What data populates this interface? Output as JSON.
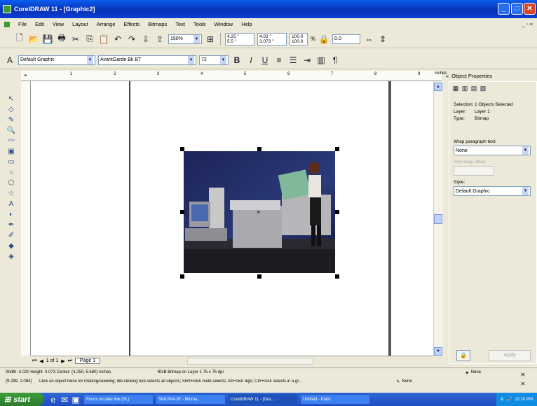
{
  "window": {
    "title": "CorelDRAW 11 - [Graphic2]",
    "buttons": {
      "minimize": "_",
      "maximize": "□",
      "close": "✕"
    }
  },
  "menubar": {
    "items": [
      "File",
      "Edit",
      "View",
      "Layout",
      "Arrange",
      "Effects",
      "Bitmaps",
      "Text",
      "Tools",
      "Window",
      "Help"
    ],
    "doc_controls": "_ ▫ ×"
  },
  "toolbar_standard": {
    "zoom_value": "150%",
    "snap_value": "",
    "x_value": "4.25 \"",
    "y_value": "5.5 \"",
    "w_value": "4.02 \"",
    "h_value": "3.073 \"",
    "scale_x": "100.0",
    "scale_y": "100.0",
    "pct": "%",
    "rotation_value": "0.0"
  },
  "toolbar_text": {
    "style_select": "Default Graphic",
    "font_select": "AvantGarde Bk BT",
    "size_select": "72",
    "bold": "B",
    "italic": "I",
    "underline": "U"
  },
  "ruler": {
    "top_label": "inches",
    "ticks": [
      "1",
      "2",
      "3",
      "4",
      "5",
      "6",
      "7",
      "8",
      "9"
    ]
  },
  "docker": {
    "title": "Object Properties",
    "selection_label": "Selection:",
    "selection_value": "1 Objects Selected",
    "layer_label": "Layer:",
    "layer_value": "Layer 1",
    "type_label": "Type:",
    "type_value": "Bitmap",
    "wrap_label": "Wrap paragraph text:",
    "wrap_value": "None",
    "text_wrap_offset_label": "Text wrap offset",
    "style_label": "Style:",
    "style_value": "Default Graphic",
    "apply_label": "Apply"
  },
  "page_tabs": {
    "page_count": "1 of 1",
    "page_tab": "Page 1"
  },
  "status": {
    "line1_left": "Width: 4.020  Height: 3.073  Center: (4.250, 5.580)  inches",
    "line1_mid": "RGB Bitmap on Layer 1 75 x 75 dpi",
    "line1_right_fill": "None",
    "line2_left": "(9.299, 1.084)",
    "line2_mid": "Click an object twice for rotating/skewing; dbl-clicking tool selects all objects; Shift+click multi-selects; Alt+click digs; Ctrl+click selects in a gr...",
    "line2_right_outline": "None"
  },
  "taskbar": {
    "start_label": "start",
    "items": [
      "Focus on dale link (SL)",
      "SIIA PAA 07 - Micros...",
      "CorelDRAW 11 - [Gra...",
      "Untitled - Paint"
    ],
    "clock": "12:10 PM"
  },
  "colors": {
    "title_blue": "#0a5ff0",
    "taskbar_blue": "#3168d5",
    "start_green": "#3c9c3a",
    "selection_handle": "#000000"
  }
}
